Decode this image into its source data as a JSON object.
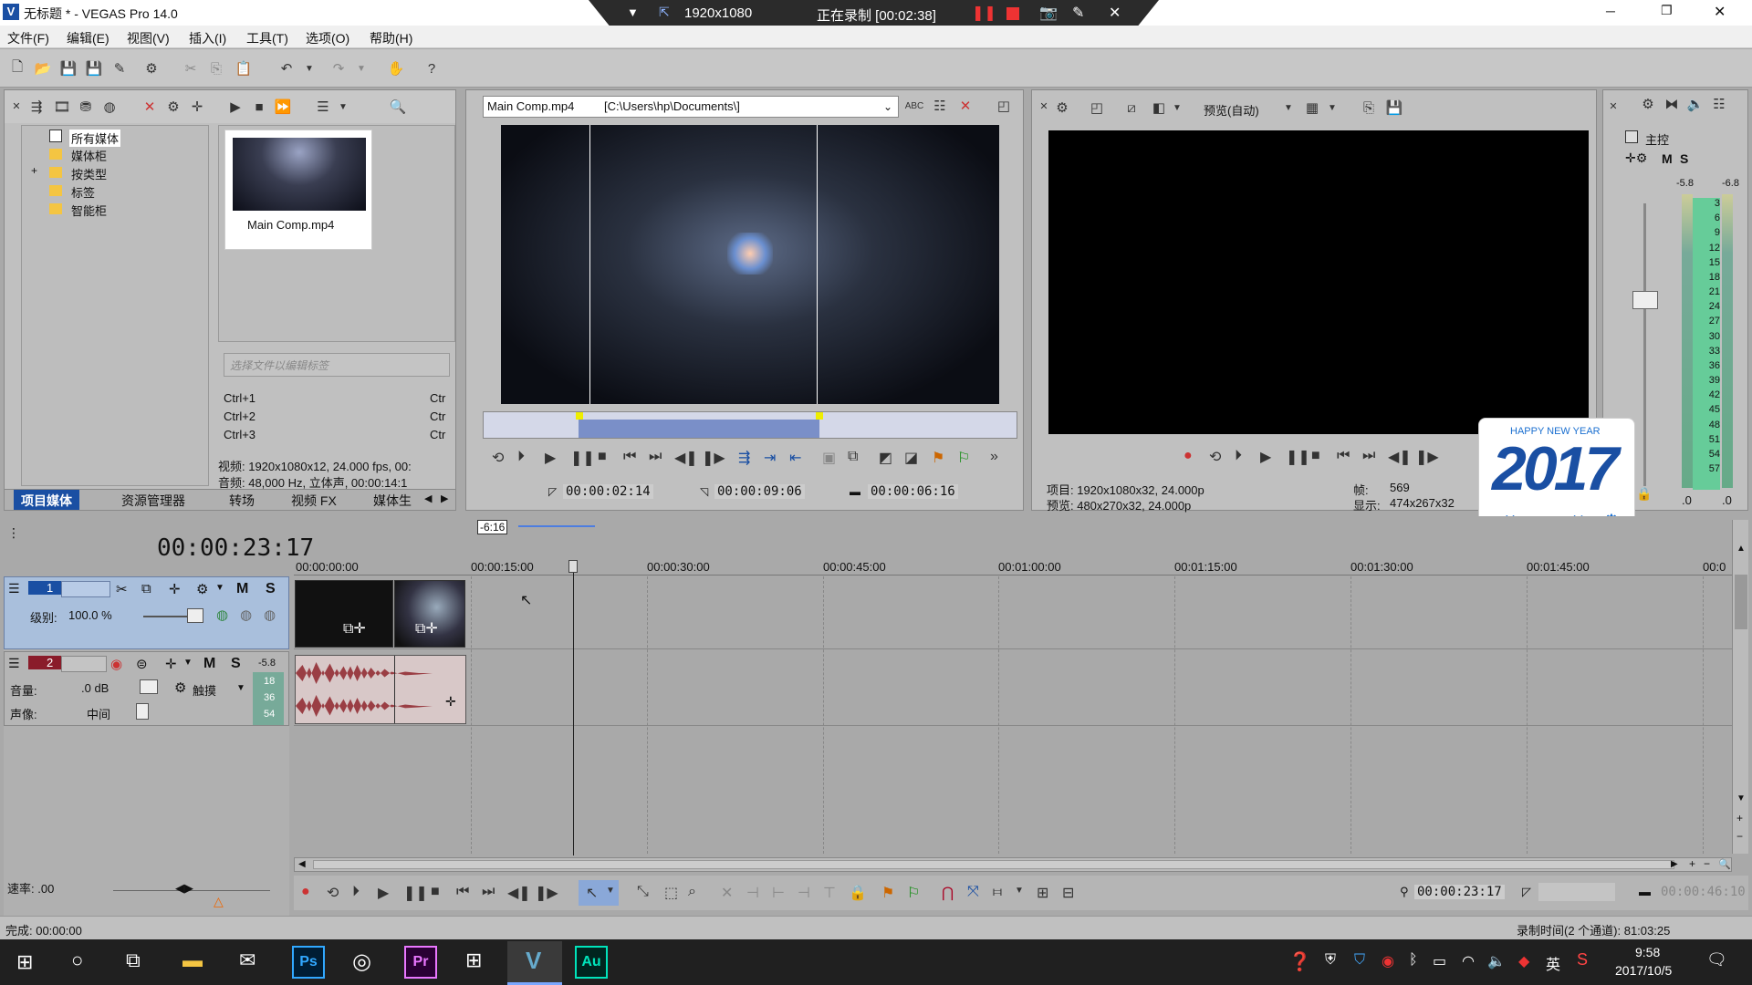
{
  "window": {
    "title": "无标题 * - VEGAS Pro 14.0"
  },
  "window_controls": {
    "minimize": "─",
    "restore": "❐",
    "close": "✕"
  },
  "menu": [
    "文件(F)",
    "编辑(E)",
    "视图(V)",
    "插入(I)",
    "工具(T)",
    "选项(O)",
    "帮助(H)"
  ],
  "recorder": {
    "resolution": "1920x1080",
    "status": "正在录制 [00:02:38]"
  },
  "explorer": {
    "tree": [
      "所有媒体",
      "媒体柜",
      "按类型",
      "标签",
      "智能柜"
    ],
    "expand": "+",
    "media_item": "Main Comp.mp4",
    "tag_placeholder": "选择文件以编辑标签",
    "shortcuts": [
      {
        "key": "Ctrl+1",
        "extra": "Ctr"
      },
      {
        "key": "Ctrl+2",
        "extra": "Ctr"
      },
      {
        "key": "Ctrl+3",
        "extra": "Ctr"
      }
    ],
    "info_video": "视频: 1920x1080x12, 24.000 fps, 00:",
    "info_audio": "音频: 48,000 Hz, 立体声, 00:00:14:1",
    "tabs": [
      "项目媒体",
      "资源管理器",
      "转场",
      "视频 FX",
      "媒体生"
    ]
  },
  "trimmer": {
    "file": "Main Comp.mp4",
    "path": "[C:\\Users\\hp\\Documents\\]",
    "time_in": "00:00:02:14",
    "time_out": "00:00:09:06",
    "duration": "00:00:06:16"
  },
  "preview": {
    "quality": "预览(自动)",
    "project_label": "项目: 1920x1080x32, 24.000p",
    "preview_label": "预览: 480x270x32, 24.000p",
    "frame_label": "帧:",
    "frame_value": "569",
    "display_label": "显示:",
    "display_value": "474x267x32"
  },
  "master": {
    "title": "主控",
    "m": "M",
    "s": "S",
    "peak_l": "-5.8",
    "peak_r": "-6.8",
    "scale": [
      "3",
      "6",
      "9",
      "12",
      "15",
      "18",
      "21",
      "24",
      "27",
      "30",
      "33",
      "36",
      "39",
      "42",
      "45",
      "48",
      "51",
      "54",
      "57"
    ],
    "bottom_l": ".0",
    "bottom_r": ".0"
  },
  "ime": {
    "header": "HAPPY NEW YEAR",
    "year": "2017",
    "lang": "英",
    "punct": "·,",
    "mode": "简",
    "gear": "⚙"
  },
  "timeline": {
    "cursor_time": "00:00:23:17",
    "marker": "-6:16",
    "ruler": [
      "00:00:00:00",
      "00:00:15:00",
      "00:00:30:00",
      "00:00:45:00",
      "00:01:00:00",
      "00:01:15:00",
      "00:01:30:00",
      "00:01:45:00",
      "00:0"
    ],
    "track1": {
      "num": "1",
      "m": "M",
      "s": "S",
      "level_label": "级别:",
      "level_value": "100.0 %"
    },
    "track2": {
      "num": "2",
      "m": "M",
      "s": "S",
      "peak": "-5.8",
      "vol_label": "音量:",
      "vol_value": ".0 dB",
      "pan_label": "声像:",
      "pan_value": "中间",
      "mode": "触摸",
      "meter": [
        "18",
        "36",
        "54"
      ]
    },
    "rate_label": "速率: .00",
    "transport_time": "00:00:23:17",
    "end_time": "00:00:46:10"
  },
  "status": {
    "left": "完成: 00:00:00",
    "right": "录制时间(2 个通道): 81:03:25"
  },
  "taskbar": {
    "time": "9:58",
    "date": "2017/10/5",
    "lang": "英",
    "apps": [
      "Ps",
      "Pr",
      "Au"
    ]
  },
  "colors": {
    "accent_blue": "#1a4fa3",
    "video_track": "#a9bfdc",
    "audio_wave": "#9a3e44",
    "recorder_bar": "#2b2b2b"
  }
}
